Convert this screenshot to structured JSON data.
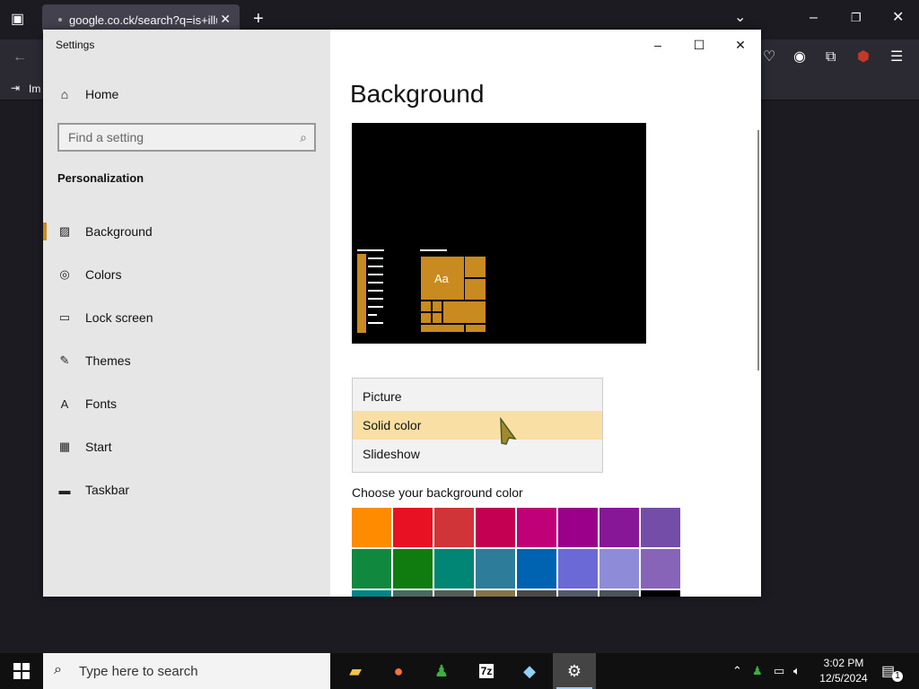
{
  "browser": {
    "tab_title": "google.co.ck/search?q=is+illustr",
    "tab_close": "✕",
    "new_tab": "+",
    "bookmark_label": "Im"
  },
  "settings": {
    "window_title": "Settings",
    "home": "Home",
    "search_placeholder": "Find a setting",
    "section_title": "Personalization",
    "nav": [
      {
        "label": "Background",
        "icon": "picture-icon"
      },
      {
        "label": "Colors",
        "icon": "palette-icon"
      },
      {
        "label": "Lock screen",
        "icon": "lock-screen-icon"
      },
      {
        "label": "Themes",
        "icon": "themes-icon"
      },
      {
        "label": "Fonts",
        "icon": "fonts-icon"
      },
      {
        "label": "Start",
        "icon": "start-icon"
      },
      {
        "label": "Taskbar",
        "icon": "taskbar-icon"
      }
    ],
    "page_title": "Background",
    "preview_tile_text": "Aa",
    "dropdown_options": [
      "Picture",
      "Solid color",
      "Slideshow"
    ],
    "dropdown_selected": "Solid color",
    "choose_label": "Choose your background color",
    "accent_color": "#c98a1f",
    "colors": [
      "#ff8c00",
      "#e81123",
      "#d13438",
      "#c30052",
      "#bf0077",
      "#9a0089",
      "#881798",
      "#744da9",
      "#10893e",
      "#107c10",
      "#018574",
      "#2d7d9a",
      "#0063b1",
      "#6b69d6",
      "#8e8cd8",
      "#8764b8",
      "#038387",
      "#486860",
      "#525e54",
      "#847545",
      "#4c4a48",
      "#515c6b",
      "#4a5459",
      "#000000"
    ]
  },
  "taskbar": {
    "search_placeholder": "Type here to search",
    "time": "3:02 PM",
    "date": "12/5/2024",
    "notification_count": "1",
    "apps": [
      "file-explorer-icon",
      "firefox-icon",
      "people-icon",
      "7zip-icon",
      "notepad-icon",
      "settings-icon"
    ]
  }
}
